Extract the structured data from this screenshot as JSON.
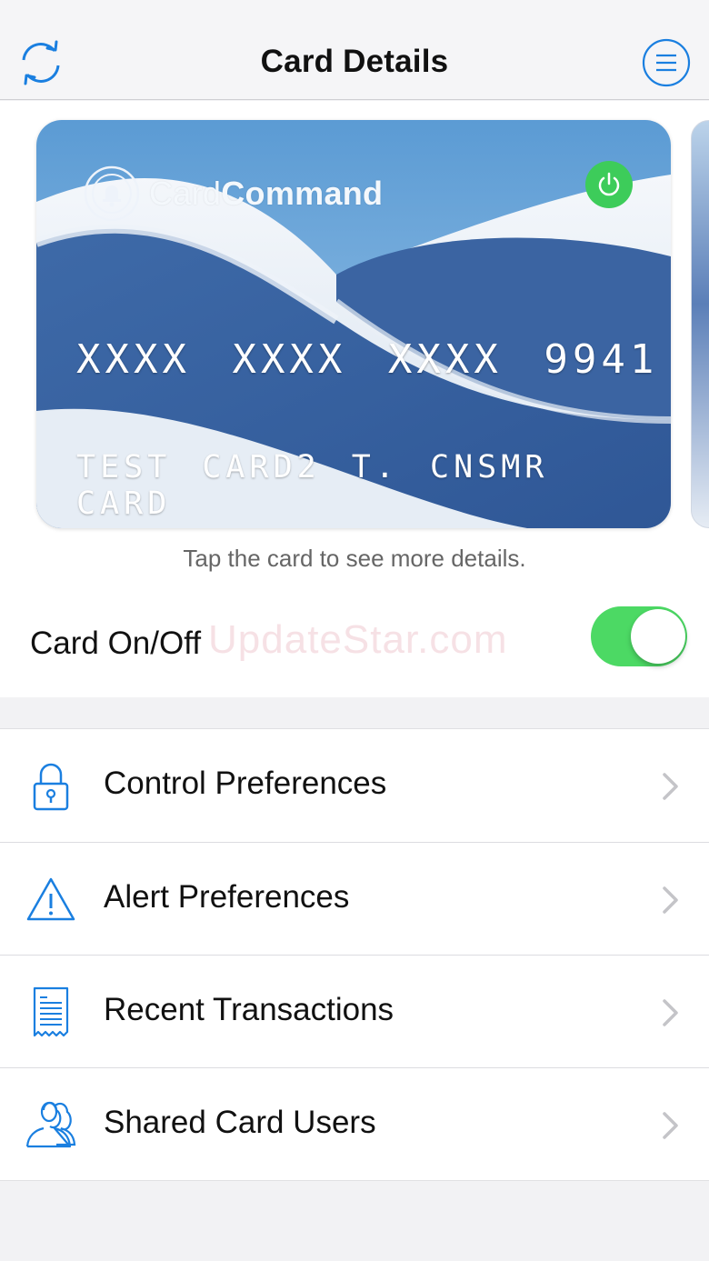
{
  "header": {
    "title": "Card Details",
    "refresh_icon": "refresh-icon",
    "menu_icon": "menu-icon"
  },
  "card": {
    "brand_light": "Card",
    "brand_bold": "Command",
    "number": "XXXX XXXX XXXX 9941",
    "holder": "TEST CARD2 T. CNSMR CARD",
    "power_icon": "power-icon"
  },
  "hint": "Tap the card to see more details.",
  "card_toggle": {
    "label": "Card On/Off",
    "enabled": true
  },
  "watermark": "UpdateStar.com",
  "menu": [
    {
      "label": "Control Preferences",
      "icon": "lock-icon"
    },
    {
      "label": "Alert Preferences",
      "icon": "warning-icon"
    },
    {
      "label": "Recent Transactions",
      "icon": "receipt-icon"
    },
    {
      "label": "Shared Card Users",
      "icon": "users-icon"
    }
  ],
  "colors": {
    "accent": "#1a7fe0",
    "toggle_on": "#4cd964",
    "power_green": "#3dcc5a"
  }
}
